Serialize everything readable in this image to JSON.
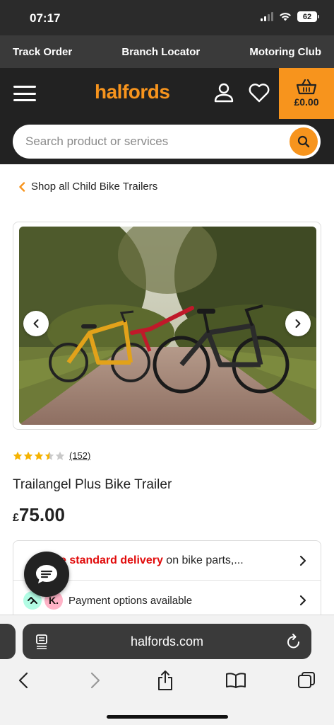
{
  "status_bar": {
    "time": "07:17",
    "battery": "62"
  },
  "utility_nav": {
    "track_order": "Track Order",
    "branch_locator": "Branch Locator",
    "motoring_club": "Motoring Club"
  },
  "header": {
    "logo": "halfords",
    "basket_total": "£0.00"
  },
  "search": {
    "placeholder": "Search product or services"
  },
  "breadcrumb": {
    "label": "Shop all Child Bike Trailers"
  },
  "product": {
    "rating": 3.5,
    "review_count": "(152)",
    "title": "Trailangel Plus Bike Trailer",
    "price_currency": "£",
    "price_amount": "75.00"
  },
  "info": {
    "delivery_strong": "e standard delivery",
    "delivery_rest": " on bike parts,...",
    "payment_label": "Payment options available",
    "klarna_letter": "K."
  },
  "browser": {
    "url": "halfords.com"
  },
  "colors": {
    "brand_orange": "#f7941d",
    "header_dark": "#222222",
    "delivery_red": "#e10a0a",
    "star_gold": "#f5b301"
  }
}
